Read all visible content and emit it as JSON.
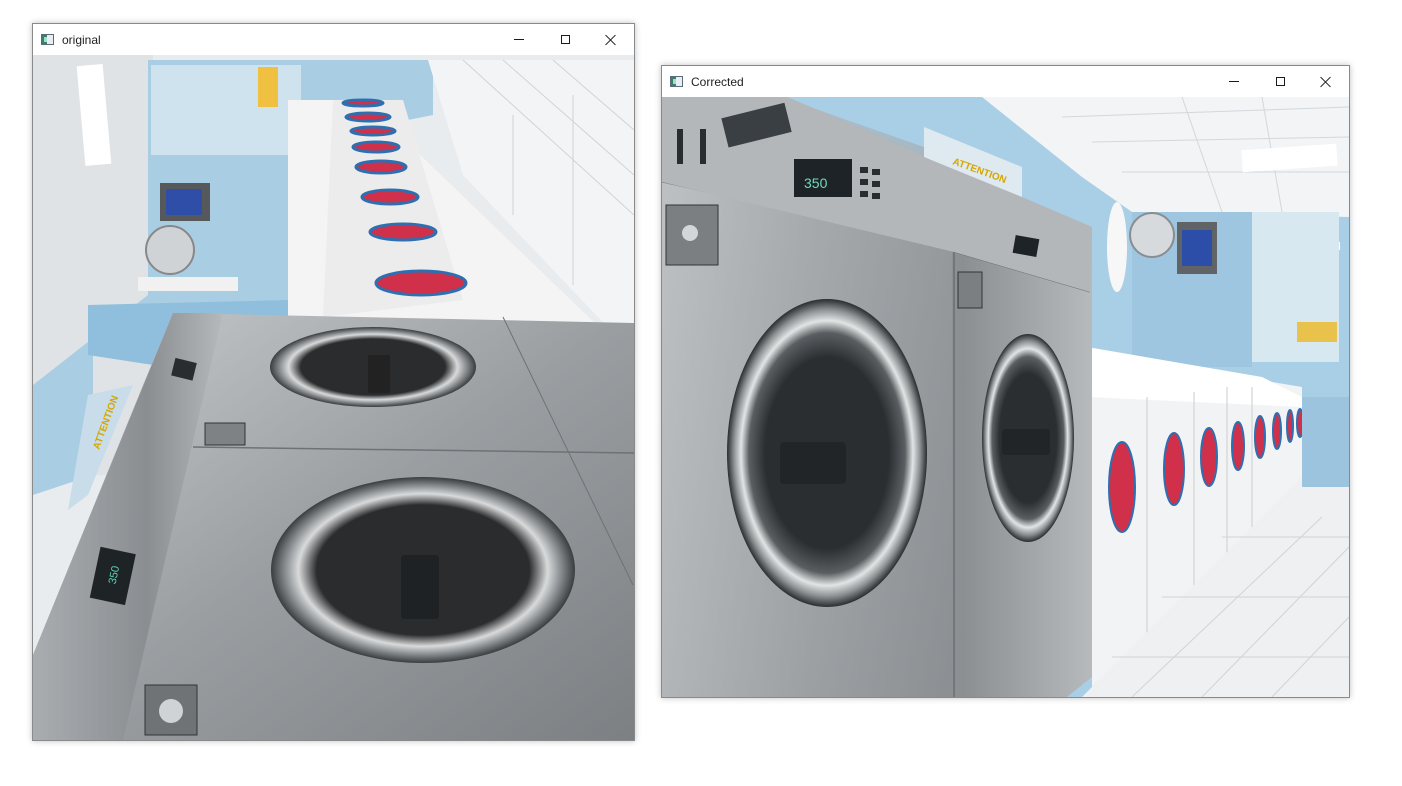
{
  "windows": {
    "original": {
      "title": "original",
      "display_value": "350"
    },
    "corrected": {
      "title": "Corrected",
      "display_value": "350",
      "sign_text": "ATTENTION"
    }
  }
}
